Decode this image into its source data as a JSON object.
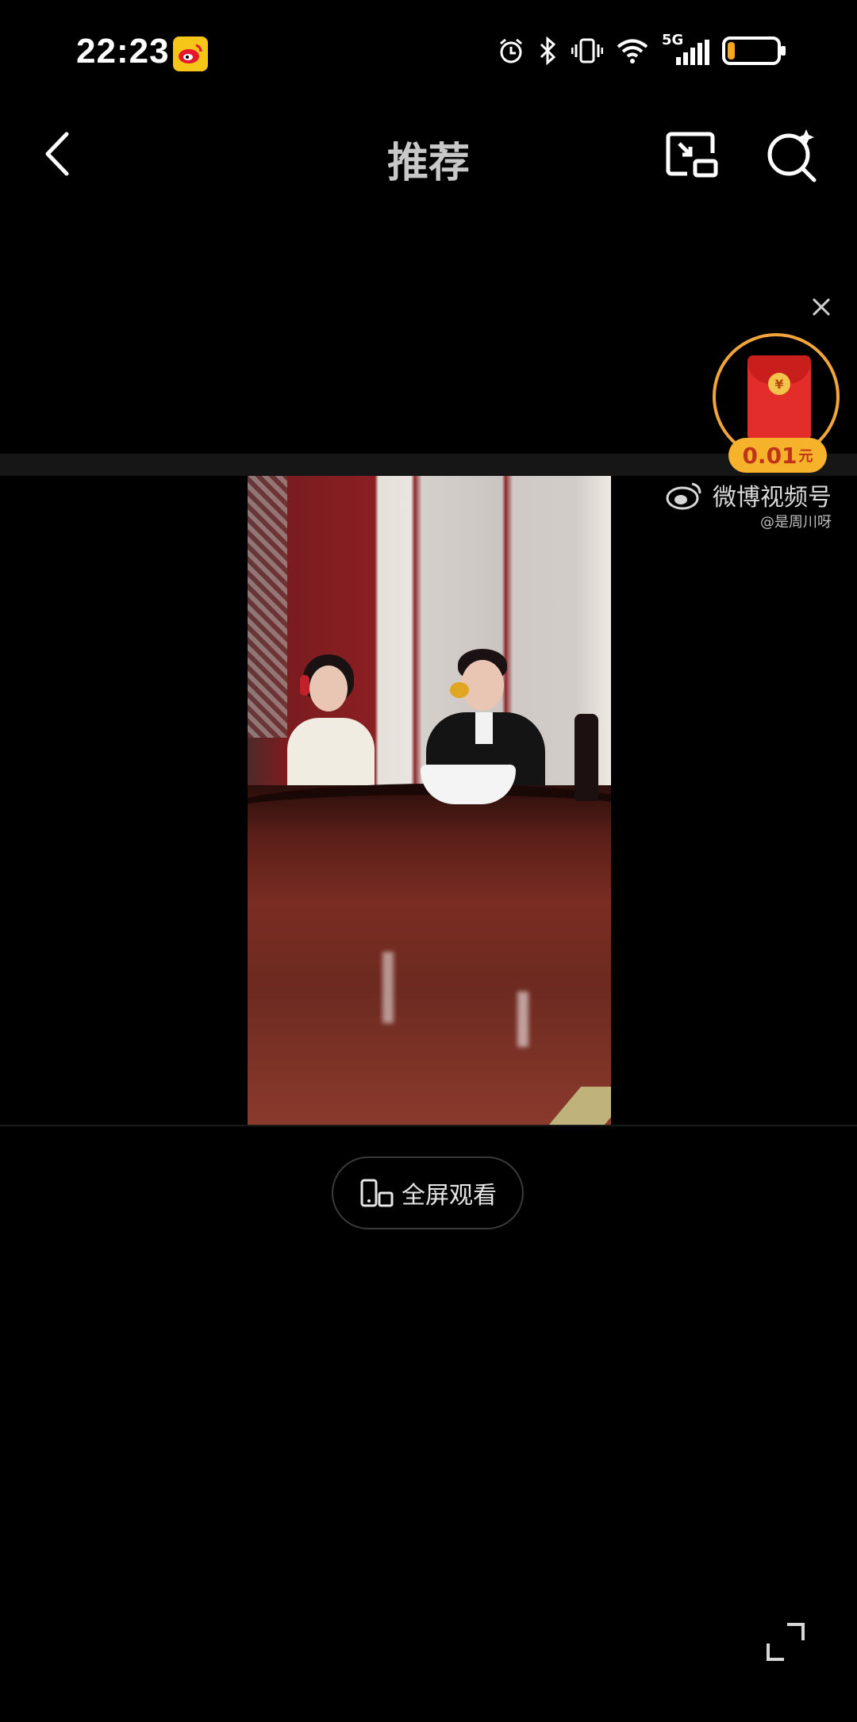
{
  "status_bar": {
    "time": "22:23",
    "network": "5G",
    "battery_level": 0.15,
    "icons": [
      "weibo-badge-icon",
      "alarm-icon",
      "bluetooth-icon",
      "vibrate-icon",
      "wifi-icon",
      "signal-icon",
      "battery-icon"
    ]
  },
  "nav": {
    "title": "推荐",
    "icons": [
      "back-arrow-icon",
      "picture-in-picture-icon",
      "search-icon"
    ]
  },
  "watermark": {
    "brand": "微博视频号",
    "user": "@是周川呀"
  },
  "red_packet": {
    "amount": "0.01",
    "unit": "元"
  },
  "fullscreen_button": {
    "label": "全屏观看"
  },
  "colors": {
    "background": "#000000",
    "accent_orange": "#f7b22c",
    "red_packet": "#e22d2a"
  }
}
